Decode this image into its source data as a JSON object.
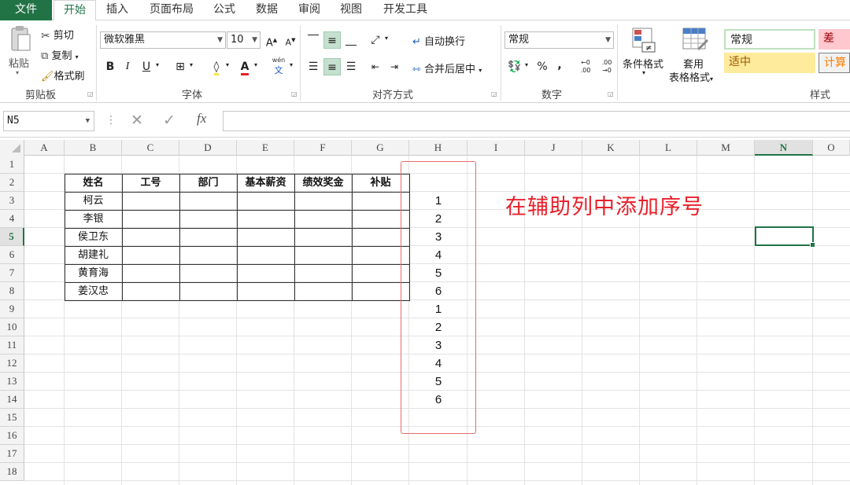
{
  "tabs": [
    "文件",
    "开始",
    "插入",
    "页面布局",
    "公式",
    "数据",
    "审阅",
    "视图",
    "开发工具"
  ],
  "active_tab": "开始",
  "ribbon": {
    "clipboard": {
      "paste": "粘贴",
      "cut": "剪切",
      "copy": "复制",
      "format_painter": "格式刷",
      "group": "剪贴板"
    },
    "font": {
      "name": "微软雅黑",
      "size": "10",
      "bold": "B",
      "italic": "I",
      "underline": "U",
      "pinyin_top": "wén",
      "pinyin_bottom": "文",
      "group": "字体"
    },
    "alignment": {
      "wrap": "自动换行",
      "merge": "合并后居中",
      "group": "对齐方式"
    },
    "number": {
      "format": "常规",
      "percent": "%",
      "comma": ",",
      "inc_decimal": "←0 .00",
      "dec_decimal": ".00 →0",
      "group": "数字"
    },
    "styles": {
      "conditional": "条件格式",
      "table_top": "套用",
      "table_bottom": "表格格式",
      "normal": "常规",
      "bad": "差",
      "neutral": "适中",
      "calc": "计算",
      "group": "样式"
    }
  },
  "formula_bar": {
    "name_box": "N5",
    "fx": "fx",
    "value": ""
  },
  "columns": [
    "A",
    "B",
    "C",
    "D",
    "E",
    "F",
    "G",
    "H",
    "I",
    "J",
    "K",
    "L",
    "M",
    "N",
    "O"
  ],
  "selected_column": "N",
  "rows": [
    "1",
    "2",
    "3",
    "4",
    "5",
    "6",
    "7",
    "8",
    "9",
    "10",
    "11",
    "12",
    "13",
    "14",
    "15",
    "16",
    "17",
    "18"
  ],
  "selected_row": "5",
  "table": {
    "headers": [
      "姓名",
      "工号",
      "部门",
      "基本薪资",
      "绩效奖金",
      "补贴"
    ],
    "names": [
      "柯云",
      "李银",
      "侯卫东",
      "胡建礼",
      "黄育海",
      "姜汉忠"
    ]
  },
  "helper_numbers": [
    "1",
    "2",
    "3",
    "4",
    "5",
    "6",
    "1",
    "2",
    "3",
    "4",
    "5",
    "6"
  ],
  "annotation": "在辅助列中添加序号",
  "colors": {
    "accent": "#217346",
    "annotation": "#e8202a",
    "box": "#e86b6b"
  }
}
